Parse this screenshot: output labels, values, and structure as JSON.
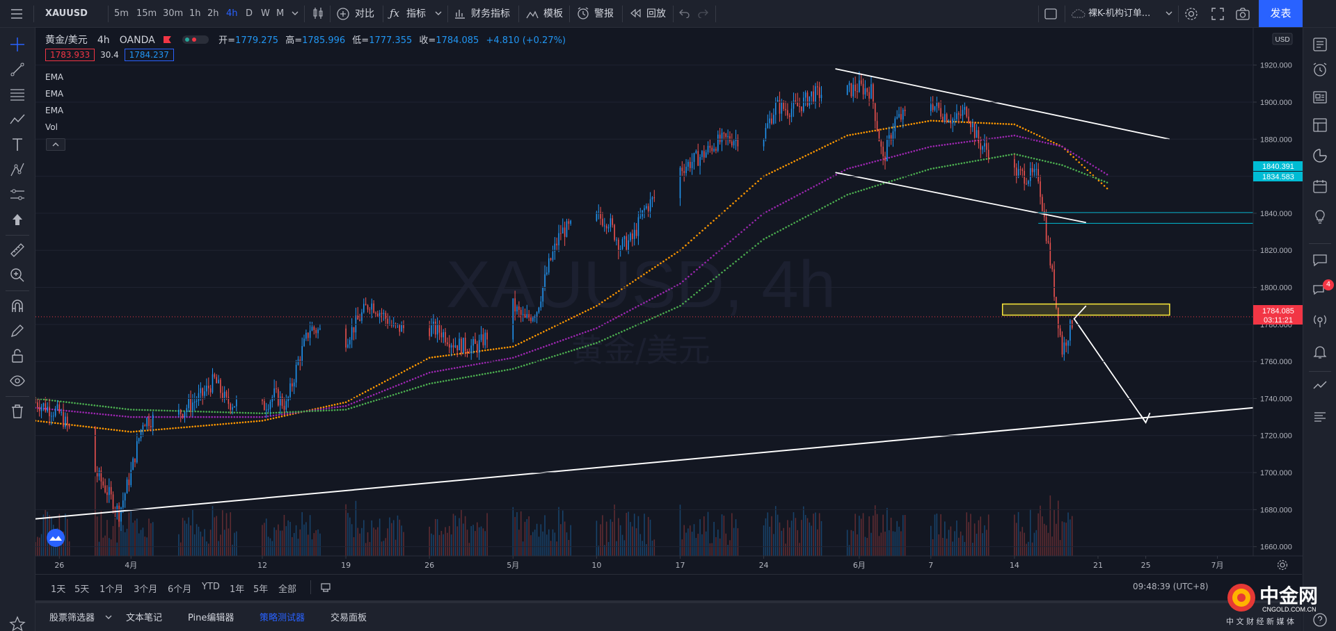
{
  "toolbar": {
    "symbol": "XAUUSD",
    "timeframes": [
      "5m",
      "15m",
      "30m",
      "1h",
      "2h",
      "4h",
      "D",
      "W",
      "M"
    ],
    "active_timeframe": "4h",
    "compare_label": "对比",
    "indicators_label": "指标",
    "financials_label": "财务指标",
    "templates_label": "模板",
    "alert_label": "警报",
    "replay_label": "回放",
    "layout_name": "裸K-机构订单...",
    "publish_label": "发表"
  },
  "legend": {
    "title": "黄金/美元",
    "interval": "4h",
    "source": "OANDA",
    "open_label": "开=",
    "open": "1779.275",
    "high_label": "高=",
    "high": "1785.996",
    "low_label": "低=",
    "low": "1777.355",
    "close_label": "收=",
    "close": "1784.085",
    "change": "+4.810 (+0.27%)",
    "bid": "1783.933",
    "spread": "30.4",
    "ask": "1784.237",
    "indicators": [
      "EMA",
      "EMA",
      "EMA",
      "Vol"
    ]
  },
  "watermark": {
    "symbol": "XAUUSD, 4h",
    "name": "黄金/美元"
  },
  "price_axis": {
    "currency": "USD",
    "labels": [
      "1920.000",
      "1900.000",
      "1880.000",
      "1860.000",
      "1840.000",
      "1820.000",
      "1800.000",
      "1780.000",
      "1760.000",
      "1740.000",
      "1720.000",
      "1700.000",
      "1680.000",
      "1660.000"
    ],
    "current_price": "1784.085",
    "countdown": "03:11:21",
    "marker_1": "1840.391",
    "marker_2": "1834.583"
  },
  "time_axis": {
    "labels": [
      "26",
      "4月",
      "12",
      "19",
      "26",
      "5月",
      "10",
      "17",
      "24",
      "6月",
      "7",
      "14",
      "21",
      "25",
      "7月"
    ]
  },
  "range_bar": {
    "ranges": [
      "1天",
      "5天",
      "1个月",
      "3个月",
      "6个月",
      "YTD",
      "1年",
      "5年",
      "全部"
    ],
    "clock": "09:48:39 (UTC+8)"
  },
  "bottom_tabs": {
    "tabs": [
      "股票筛选器",
      "文本笔记",
      "Pine编辑器",
      "策略测试器",
      "交易面板"
    ],
    "active": "策略测试器"
  },
  "watermark_brand": {
    "name": "中金网",
    "url": "CNGOLD.COM.CN",
    "slogan": "中 文 财 经 新 媒 体"
  },
  "notifications_count": "4",
  "colors": {
    "background": "#131722",
    "up": "#2196f3",
    "down": "#ef5350",
    "ema_fast": "#ff9800",
    "ema_mid": "#9c27b0",
    "ema_slow": "#4caf50",
    "accent": "#2962ff",
    "zone": "#ffeb3b"
  },
  "chart_data": {
    "type": "candlestick",
    "symbol": "XAUUSD",
    "interval": "4h",
    "ylim": [
      1655,
      1930
    ],
    "x_start": "2021-03-24",
    "x_end": "2021-07-04",
    "price_path": [
      [
        "2021-03-24",
        1738
      ],
      [
        "2021-03-26",
        1732
      ],
      [
        "2021-03-30",
        1690
      ],
      [
        "2021-03-31",
        1678
      ],
      [
        "2021-04-01",
        1700
      ],
      [
        "2021-04-02",
        1728
      ],
      [
        "2021-04-05",
        1732
      ],
      [
        "2021-04-07",
        1742
      ],
      [
        "2021-04-08",
        1750
      ],
      [
        "2021-04-09",
        1738
      ],
      [
        "2021-04-12",
        1735
      ],
      [
        "2021-04-13",
        1742
      ],
      [
        "2021-04-14",
        1736
      ],
      [
        "2021-04-15",
        1760
      ],
      [
        "2021-04-16",
        1778
      ],
      [
        "2021-04-19",
        1772
      ],
      [
        "2021-04-21",
        1792
      ],
      [
        "2021-04-22",
        1786
      ],
      [
        "2021-04-23",
        1778
      ],
      [
        "2021-04-26",
        1778
      ],
      [
        "2021-04-27",
        1776
      ],
      [
        "2021-04-28",
        1770
      ],
      [
        "2021-04-29",
        1768
      ],
      [
        "2021-04-30",
        1768
      ],
      [
        "2021-05-03",
        1790
      ],
      [
        "2021-05-04",
        1782
      ],
      [
        "2021-05-05",
        1788
      ],
      [
        "2021-05-06",
        1812
      ],
      [
        "2021-05-07",
        1830
      ],
      [
        "2021-05-10",
        1838
      ],
      [
        "2021-05-11",
        1836
      ],
      [
        "2021-05-12",
        1822
      ],
      [
        "2021-05-13",
        1826
      ],
      [
        "2021-05-14",
        1842
      ],
      [
        "2021-05-17",
        1864
      ],
      [
        "2021-05-18",
        1868
      ],
      [
        "2021-05-19",
        1872
      ],
      [
        "2021-05-20",
        1878
      ],
      [
        "2021-05-21",
        1880
      ],
      [
        "2021-05-24",
        1882
      ],
      [
        "2021-05-25",
        1898
      ],
      [
        "2021-05-26",
        1896
      ],
      [
        "2021-05-27",
        1898
      ],
      [
        "2021-05-28",
        1904
      ],
      [
        "2021-05-31",
        1906
      ],
      [
        "2021-06-01",
        1908
      ],
      [
        "2021-06-02",
        1906
      ],
      [
        "2021-06-03",
        1868
      ],
      [
        "2021-06-04",
        1890
      ],
      [
        "2021-06-07",
        1900
      ],
      [
        "2021-06-08",
        1894
      ],
      [
        "2021-06-09",
        1890
      ],
      [
        "2021-06-10",
        1896
      ],
      [
        "2021-06-11",
        1878
      ],
      [
        "2021-06-14",
        1862
      ],
      [
        "2021-06-15",
        1860
      ],
      [
        "2021-06-16",
        1860
      ],
      [
        "2021-06-17",
        1814
      ],
      [
        "2021-06-18",
        1766
      ],
      [
        "2021-06-19",
        1784
      ]
    ],
    "volume_max": 100,
    "series": [
      {
        "name": "EMA",
        "color": "#ff9800",
        "points": [
          [
            "2021-03-24",
            1728
          ],
          [
            "2021-04-01",
            1722
          ],
          [
            "2021-04-12",
            1728
          ],
          [
            "2021-04-19",
            1738
          ],
          [
            "2021-04-26",
            1762
          ],
          [
            "2021-05-03",
            1768
          ],
          [
            "2021-05-10",
            1790
          ],
          [
            "2021-05-17",
            1820
          ],
          [
            "2021-05-24",
            1860
          ],
          [
            "2021-05-31",
            1882
          ],
          [
            "2021-06-07",
            1890
          ],
          [
            "2021-06-14",
            1888
          ],
          [
            "2021-06-18",
            1876
          ],
          [
            "2021-06-22",
            1852
          ]
        ]
      },
      {
        "name": "EMA",
        "color": "#9c27b0",
        "points": [
          [
            "2021-03-24",
            1735
          ],
          [
            "2021-04-01",
            1730
          ],
          [
            "2021-04-12",
            1730
          ],
          [
            "2021-04-19",
            1736
          ],
          [
            "2021-04-26",
            1754
          ],
          [
            "2021-05-03",
            1762
          ],
          [
            "2021-05-10",
            1778
          ],
          [
            "2021-05-17",
            1802
          ],
          [
            "2021-05-24",
            1840
          ],
          [
            "2021-05-31",
            1864
          ],
          [
            "2021-06-07",
            1876
          ],
          [
            "2021-06-14",
            1882
          ],
          [
            "2021-06-18",
            1876
          ],
          [
            "2021-06-22",
            1860
          ]
        ]
      },
      {
        "name": "EMA",
        "color": "#4caf50",
        "points": [
          [
            "2021-03-24",
            1740
          ],
          [
            "2021-04-01",
            1734
          ],
          [
            "2021-04-12",
            1732
          ],
          [
            "2021-04-19",
            1734
          ],
          [
            "2021-04-26",
            1748
          ],
          [
            "2021-05-03",
            1756
          ],
          [
            "2021-05-10",
            1770
          ],
          [
            "2021-05-17",
            1790
          ],
          [
            "2021-05-24",
            1826
          ],
          [
            "2021-05-31",
            1850
          ],
          [
            "2021-06-07",
            1864
          ],
          [
            "2021-06-14",
            1872
          ],
          [
            "2021-06-18",
            1866
          ],
          [
            "2021-06-22",
            1856
          ]
        ]
      }
    ],
    "drawings": {
      "channel_upper": [
        [
          "2021-05-30",
          1918
        ],
        [
          "2021-06-27",
          1880
        ]
      ],
      "channel_lower": [
        [
          "2021-05-30",
          1862
        ],
        [
          "2021-06-20",
          1835
        ]
      ],
      "trendline_support": [
        [
          "2021-03-24",
          1675
        ],
        [
          "2021-07-04",
          1735
        ]
      ],
      "supply_zone": {
        "x0": "2021-06-13",
        "x1": "2021-06-27",
        "y0": 1791,
        "y1": 1785
      },
      "arrow": [
        [
          "2021-06-20",
          1790
        ],
        [
          "2021-06-19",
          1783
        ],
        [
          "2021-06-25",
          1727
        ]
      ]
    }
  }
}
